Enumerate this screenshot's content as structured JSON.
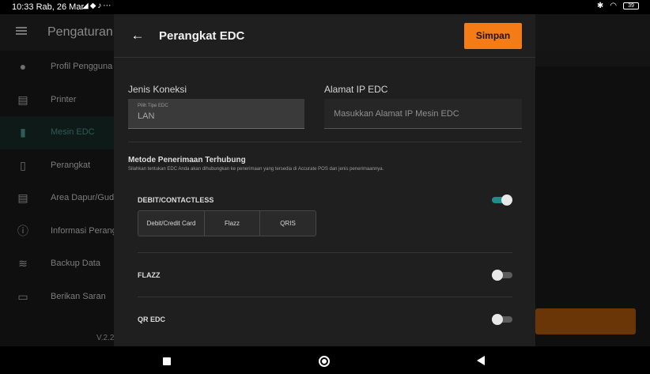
{
  "status_bar": {
    "time": "10:33 Rab, 26 Mar",
    "battery": "39"
  },
  "background": {
    "title": "Pengaturan",
    "sidebar": [
      {
        "label": "Profil Pengguna",
        "icon": "person-icon"
      },
      {
        "label": "Printer",
        "icon": "printer-icon"
      },
      {
        "label": "Mesin EDC",
        "icon": "edc-icon"
      },
      {
        "label": "Perangkat",
        "icon": "device-icon"
      },
      {
        "label": "Area Dapur/Gud",
        "icon": "kitchen-printer-icon"
      },
      {
        "label": "Informasi Perang",
        "icon": "info-icon"
      },
      {
        "label": "Backup Data",
        "icon": "database-icon"
      },
      {
        "label": "Berikan Saran",
        "icon": "feedback-icon"
      }
    ],
    "version": "V.2.2"
  },
  "dialog": {
    "title": "Perangkat EDC",
    "save_label": "Simpan",
    "connection": {
      "label": "Jenis Koneksi",
      "hint": "Pilih Tipe EDC",
      "value": "LAN"
    },
    "ip": {
      "label": "Alamat IP EDC",
      "placeholder": "Masukkan Alamat IP Mesin EDC"
    },
    "method": {
      "title": "Metode Penerimaan Terhubung",
      "description": "Silahkan tentukan EDC Anda akan dihubungkan ke penerimaan yang tersedia di Accurate POS dan jenis penerimaannya."
    },
    "debit": {
      "label": "DEBIT/CONTACTLESS",
      "enabled": true,
      "options": [
        "Debit/Credit Card",
        "Flazz",
        "QRIS"
      ]
    },
    "flazz": {
      "label": "FLAZZ",
      "enabled": false
    },
    "qr": {
      "label": "QR EDC",
      "enabled": false
    }
  },
  "colors": {
    "accent": "#f47c16",
    "toggle_on": "#238b8b"
  }
}
